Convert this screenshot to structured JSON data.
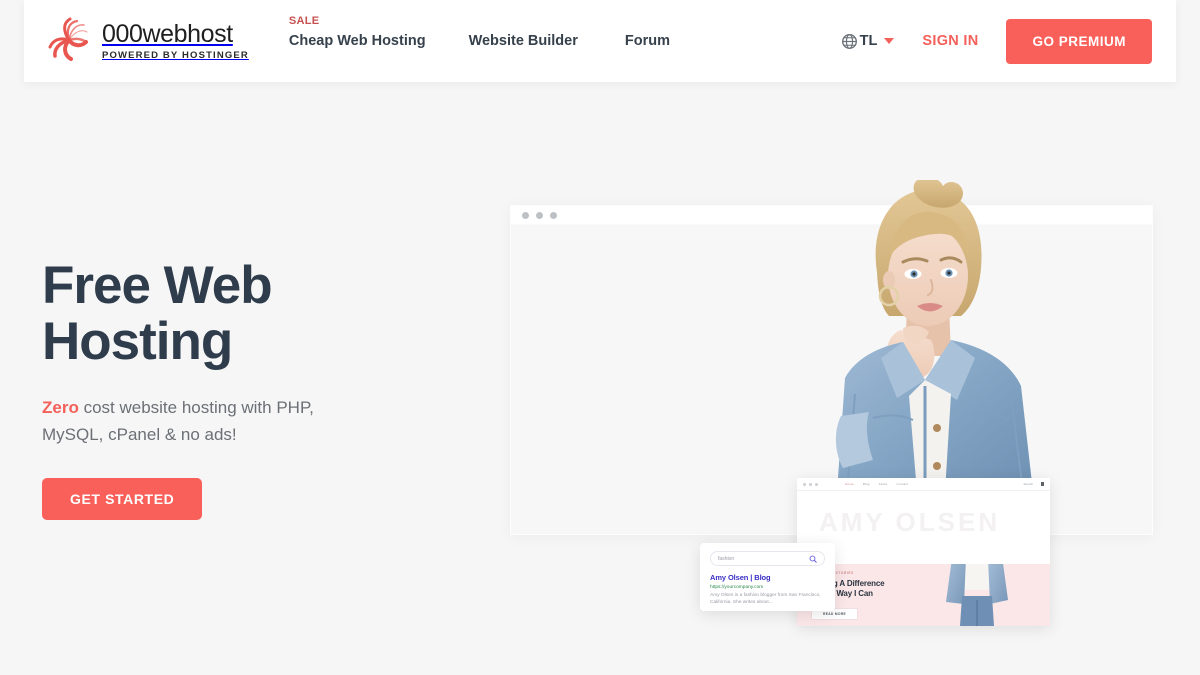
{
  "brand": {
    "name": "000webhost",
    "tagline": "POWERED BY HOSTINGER",
    "logo_icon": "pinwheel-swirl-logo",
    "logo_color": "#e8564f"
  },
  "header": {
    "nav": [
      {
        "label": "Cheap Web Hosting",
        "badge": "SALE"
      },
      {
        "label": "Website Builder",
        "badge": null
      },
      {
        "label": "Forum",
        "badge": null
      }
    ],
    "language": {
      "icon": "globe-icon",
      "code": "TL",
      "caret_icon": "chevron-down-icon"
    },
    "sign_in_label": "SIGN IN",
    "premium_label": "GO PREMIUM",
    "accent_color": "#fa605a",
    "sale_color": "#c8504f",
    "nav_text_color": "#36414c"
  },
  "hero": {
    "title": "Free Web Hosting",
    "subtitle_accent": "Zero",
    "subtitle_rest": " cost website hosting with PHP, MySQL, cPanel & no ads!",
    "cta_label": "GET STARTED",
    "title_color": "#2f3c4c",
    "subtitle_color": "#6c7076"
  },
  "mockup": {
    "browser_dots": 3,
    "mini_site": {
      "nav": [
        "Home",
        "Blog",
        "About",
        "Contact"
      ],
      "search_label": "Search",
      "cart_icon": "shopping-bag-icon",
      "wordmark": "AMY OLSEN",
      "kicker": "MY LATEST STORIES",
      "headline": "Making A Difference\nIn Any Way I Can",
      "button_label": "READ MORE",
      "pink_color": "#fbe7e8"
    },
    "search_result": {
      "query": "fashion",
      "search_icon": "search-icon",
      "title": "Amy Olsen | Blog",
      "url": "https://yourcompany.com",
      "description": "Amy Olsen is a fashion blogger from San Francisco, California. She writes about...",
      "title_color": "#3a2fc4",
      "url_color": "#2a8a4a"
    }
  },
  "page": {
    "background_color": "#f6f6f6"
  }
}
